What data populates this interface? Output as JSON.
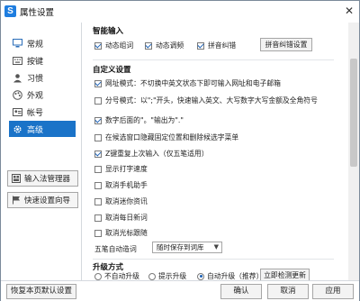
{
  "window": {
    "title": "属性设置",
    "app_icon_glyph": "S",
    "close_glyph": "✕"
  },
  "sidebar": {
    "items": [
      {
        "label": "常规",
        "icon": "monitor-icon"
      },
      {
        "label": "按键",
        "icon": "keyboard-icon"
      },
      {
        "label": "习惯",
        "icon": "person-icon"
      },
      {
        "label": "外观",
        "icon": "palette-icon"
      },
      {
        "label": "帐号",
        "icon": "account-icon"
      },
      {
        "label": "高级",
        "icon": "gear-icon",
        "active": true
      }
    ],
    "buttons": [
      {
        "label": "输入法管理器",
        "icon": "manager-icon"
      },
      {
        "label": "快速设置向导",
        "icon": "flag-icon"
      }
    ]
  },
  "smart_input": {
    "title": "智能输入",
    "options": [
      {
        "label": "动态组词",
        "checked": true
      },
      {
        "label": "动态调频",
        "checked": true
      },
      {
        "label": "拼音纠错",
        "checked": true
      }
    ],
    "button": "拼音纠错设置"
  },
  "custom": {
    "title": "自定义设置",
    "options": [
      {
        "label": "网址模式：不切换中英文状态下即可输入网址和电子邮箱",
        "checked": true
      },
      {
        "label": "分号模式：以\";\"开头，快速输入英文、大写数字大写金额及全角符号",
        "checked": false
      },
      {
        "label": "数字后面的\"。\"输出为\".\"",
        "checked": true
      },
      {
        "label": "在候选窗口隐藏固定位置和删除候选字菜单",
        "checked": false
      },
      {
        "label": "Z键重复上次输入（仅五笔适用）",
        "checked": true
      },
      {
        "label": "显示打字速度",
        "checked": false
      },
      {
        "label": "取消手机助手",
        "checked": false
      },
      {
        "label": "取消迷你资讯",
        "checked": false
      },
      {
        "label": "取消每日新词",
        "checked": false
      },
      {
        "label": "取消光标跟随",
        "checked": false
      }
    ],
    "wubi_label": "五笔自动造词",
    "wubi_value": "随时保存到词库"
  },
  "upgrade": {
    "title": "升级方式",
    "options": [
      {
        "label": "不自动升级",
        "selected": false
      },
      {
        "label": "提示升级",
        "selected": false
      },
      {
        "label": "自动升级（推荐）",
        "selected": true
      }
    ],
    "button": "立即检测更新"
  },
  "footer": {
    "restore": "恢复本页默认设置",
    "ok": "确认",
    "cancel": "取消",
    "apply": "应用"
  },
  "colors": {
    "accent": "#1a73c8",
    "check": "#1a5fb4"
  }
}
